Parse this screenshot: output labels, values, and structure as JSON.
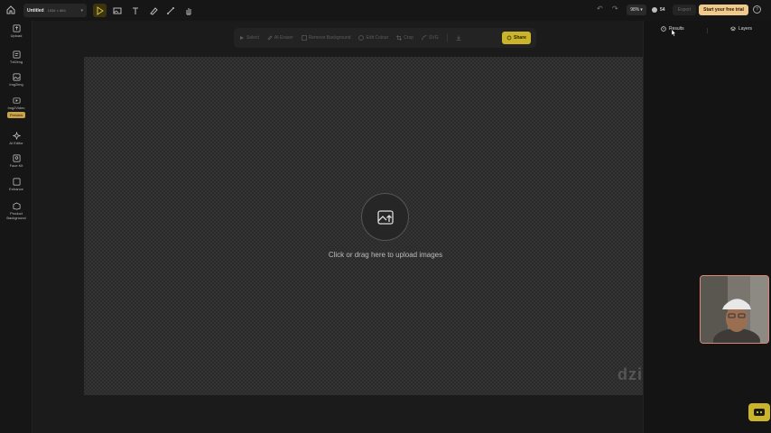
{
  "topbar": {
    "project_name": "Untitled",
    "canvas_size": "1536 × 864",
    "zoom": "98%",
    "credits": "54",
    "export_label": "Export",
    "trial_label": "Start your free trial",
    "help": "?"
  },
  "sidebar": {
    "items": [
      {
        "label": "Upload",
        "icon": "upload-icon"
      },
      {
        "label": "Txt2img",
        "icon": "text-to-image-icon"
      },
      {
        "label": "Img2img",
        "icon": "image-to-image-icon"
      },
      {
        "label": "Img2Video",
        "icon": "video-icon",
        "badge": "Preview"
      },
      {
        "label": "AI Editor",
        "icon": "ai-editor-icon"
      },
      {
        "label": "Face Kit",
        "icon": "face-kit-icon"
      },
      {
        "label": "Enhance",
        "icon": "enhance-icon"
      },
      {
        "label": "Product Background",
        "icon": "product-background-icon"
      }
    ]
  },
  "float_toolbar": {
    "items": [
      "Select",
      "AI Eraser",
      "Remove Background",
      "Edit Colour",
      "Crop",
      "SVG"
    ],
    "share_label": "Share"
  },
  "canvas": {
    "upload_text": "Click or drag here to upload images",
    "watermark": "dzi"
  },
  "right_panel": {
    "tab_results": "Results",
    "tab_layers": "Layers"
  },
  "colors": {
    "accent_yellow": "#c9b42a",
    "trial_bg": "#f0c98c",
    "background": "#1b1b1b"
  }
}
